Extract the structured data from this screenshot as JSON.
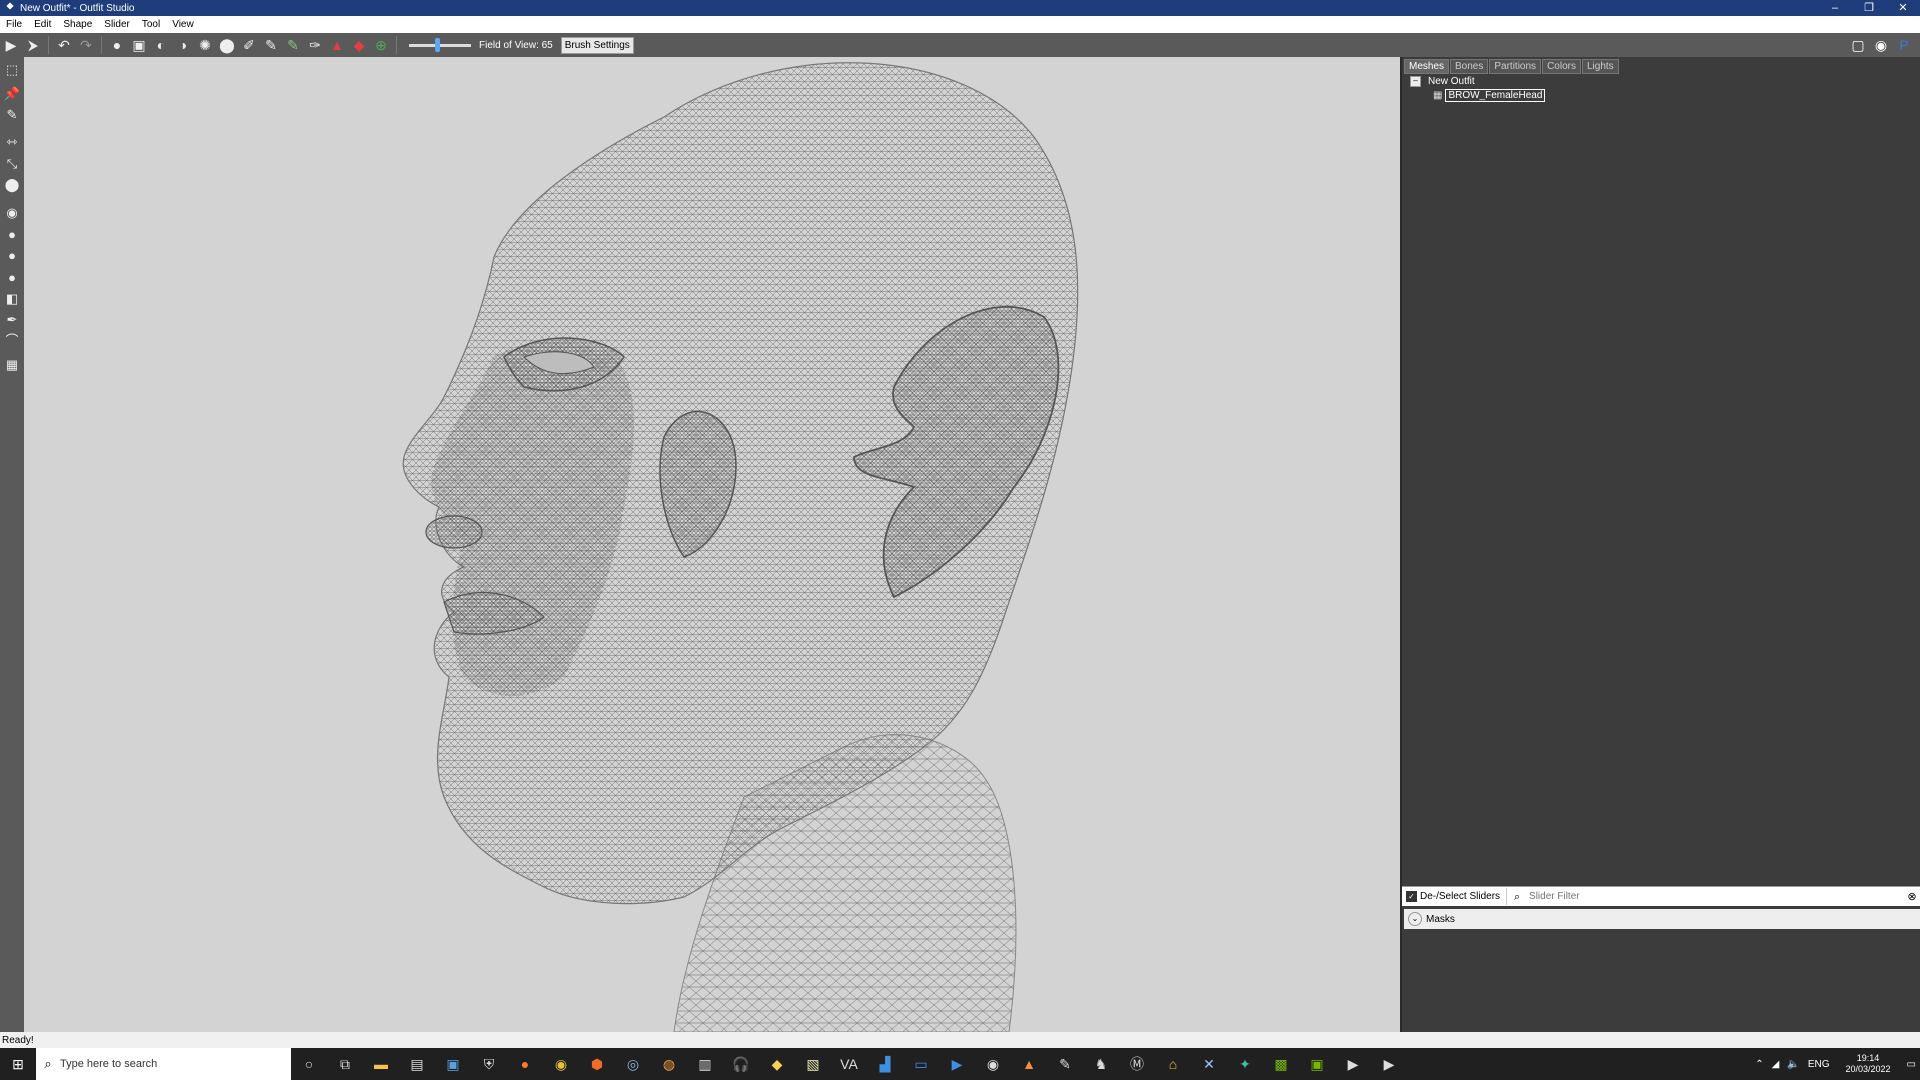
{
  "window": {
    "title": "New Outfit* - Outfit Studio",
    "app_icon": "outfit-studio-icon",
    "minimize": "–",
    "restore": "❐",
    "close": "✕"
  },
  "menu": [
    "File",
    "Edit",
    "Shape",
    "Slider",
    "Tool",
    "View"
  ],
  "toolbar": {
    "fov_label": "Field of View: 65",
    "fov_value": 65,
    "brush_settings_label": "Brush Settings",
    "icons": [
      "select-icon",
      "transform-icon",
      "undo-icon",
      "redo-icon",
      "inflate-brush-icon",
      "mask-brush-icon",
      "deflate-brush-icon",
      "move-brush-icon",
      "smooth-brush-icon",
      "weight-brush-icon",
      "color-brush-icon",
      "alpha-brush-icon",
      "collapse-icon",
      "flip-icon",
      "wireframe-icon",
      "lighting-icon"
    ],
    "right_icons": [
      "discord-icon",
      "github-icon",
      "paypal-icon"
    ]
  },
  "left_tools": [
    "pose-tool-icon",
    "pin-icon",
    "brush-icon",
    "move-icon",
    "transform-icon",
    "pivot-icon",
    "vertex-select-icon",
    "point-icon",
    "circle-icon",
    "sphere-icon",
    "edge-icon",
    "cube-icon",
    "pen-icon",
    "bend-icon",
    "grid-icon"
  ],
  "panel": {
    "tabs": [
      "Meshes",
      "Bones",
      "Partitions",
      "Colors",
      "Lights"
    ],
    "active_tab": "Meshes",
    "tree_root": "New Outfit",
    "tree_toggle": "–",
    "mesh_item": "BROW_FemaleHead"
  },
  "sliders": {
    "deselect_label": "De-/Select Sliders",
    "filter_placeholder": "Slider Filter",
    "masks_label": "Masks"
  },
  "status": "Ready!",
  "taskbar": {
    "search_placeholder": "Type here to search",
    "apps": [
      "cortana-icon",
      "taskview-icon",
      "explorer-icon",
      "photos-icon",
      "mail-icon",
      "security-icon",
      "firefox-icon",
      "chrome-icon",
      "brave-icon",
      "steam-icon",
      "blender-icon",
      "app-icon",
      "headphones-icon",
      "folder-icon",
      "notepad-icon",
      "va-icon",
      "store-icon",
      "terminal-icon",
      "media-icon",
      "obs-icon",
      "vlc-icon",
      "tool-icon",
      "horse-icon",
      "m-icon",
      "nexus-icon",
      "x-icon",
      "game-icon",
      "nvidia-icon",
      "app2-icon",
      "outfit-icon",
      "outfit2-icon"
    ],
    "lang": "ENG",
    "time": "19:14",
    "date": "20/03/2022"
  }
}
